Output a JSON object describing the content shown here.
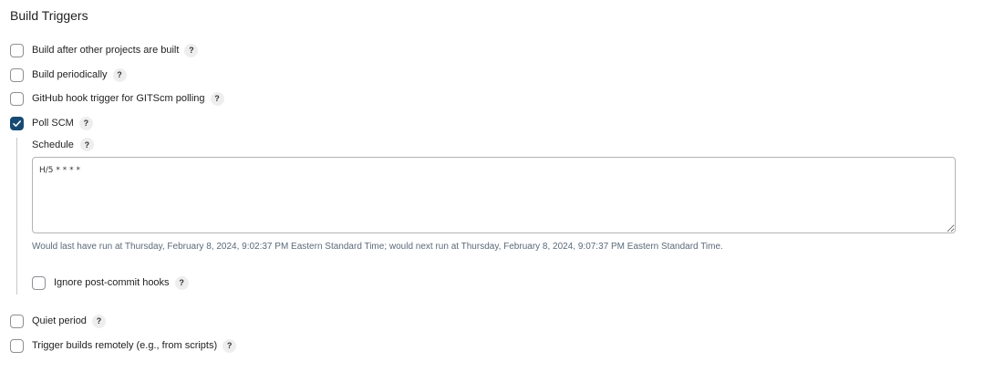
{
  "section": {
    "title": "Build Triggers"
  },
  "triggers": {
    "build_after": {
      "label": "Build after other projects are built",
      "checked": false
    },
    "build_periodically": {
      "label": "Build periodically",
      "checked": false
    },
    "github_hook": {
      "label": "GitHub hook trigger for GITScm polling",
      "checked": false
    },
    "poll_scm": {
      "label": "Poll SCM",
      "checked": true
    },
    "quiet_period": {
      "label": "Quiet period",
      "checked": false
    },
    "trigger_remotely": {
      "label": "Trigger builds remotely (e.g., from scripts)",
      "checked": false
    }
  },
  "poll_scm_config": {
    "schedule_label": "Schedule",
    "schedule_value": "H/5 * * * *",
    "hint": "Would last have run at Thursday, February 8, 2024, 9:02:37 PM Eastern Standard Time; would next run at Thursday, February 8, 2024, 9:07:37 PM Eastern Standard Time.",
    "ignore_post_commit_label": "Ignore post-commit hooks",
    "ignore_post_commit_checked": false
  },
  "help_glyph": "?",
  "colors": {
    "checkbox_checked": "#164a72",
    "hint_text": "#5b6a7a"
  }
}
